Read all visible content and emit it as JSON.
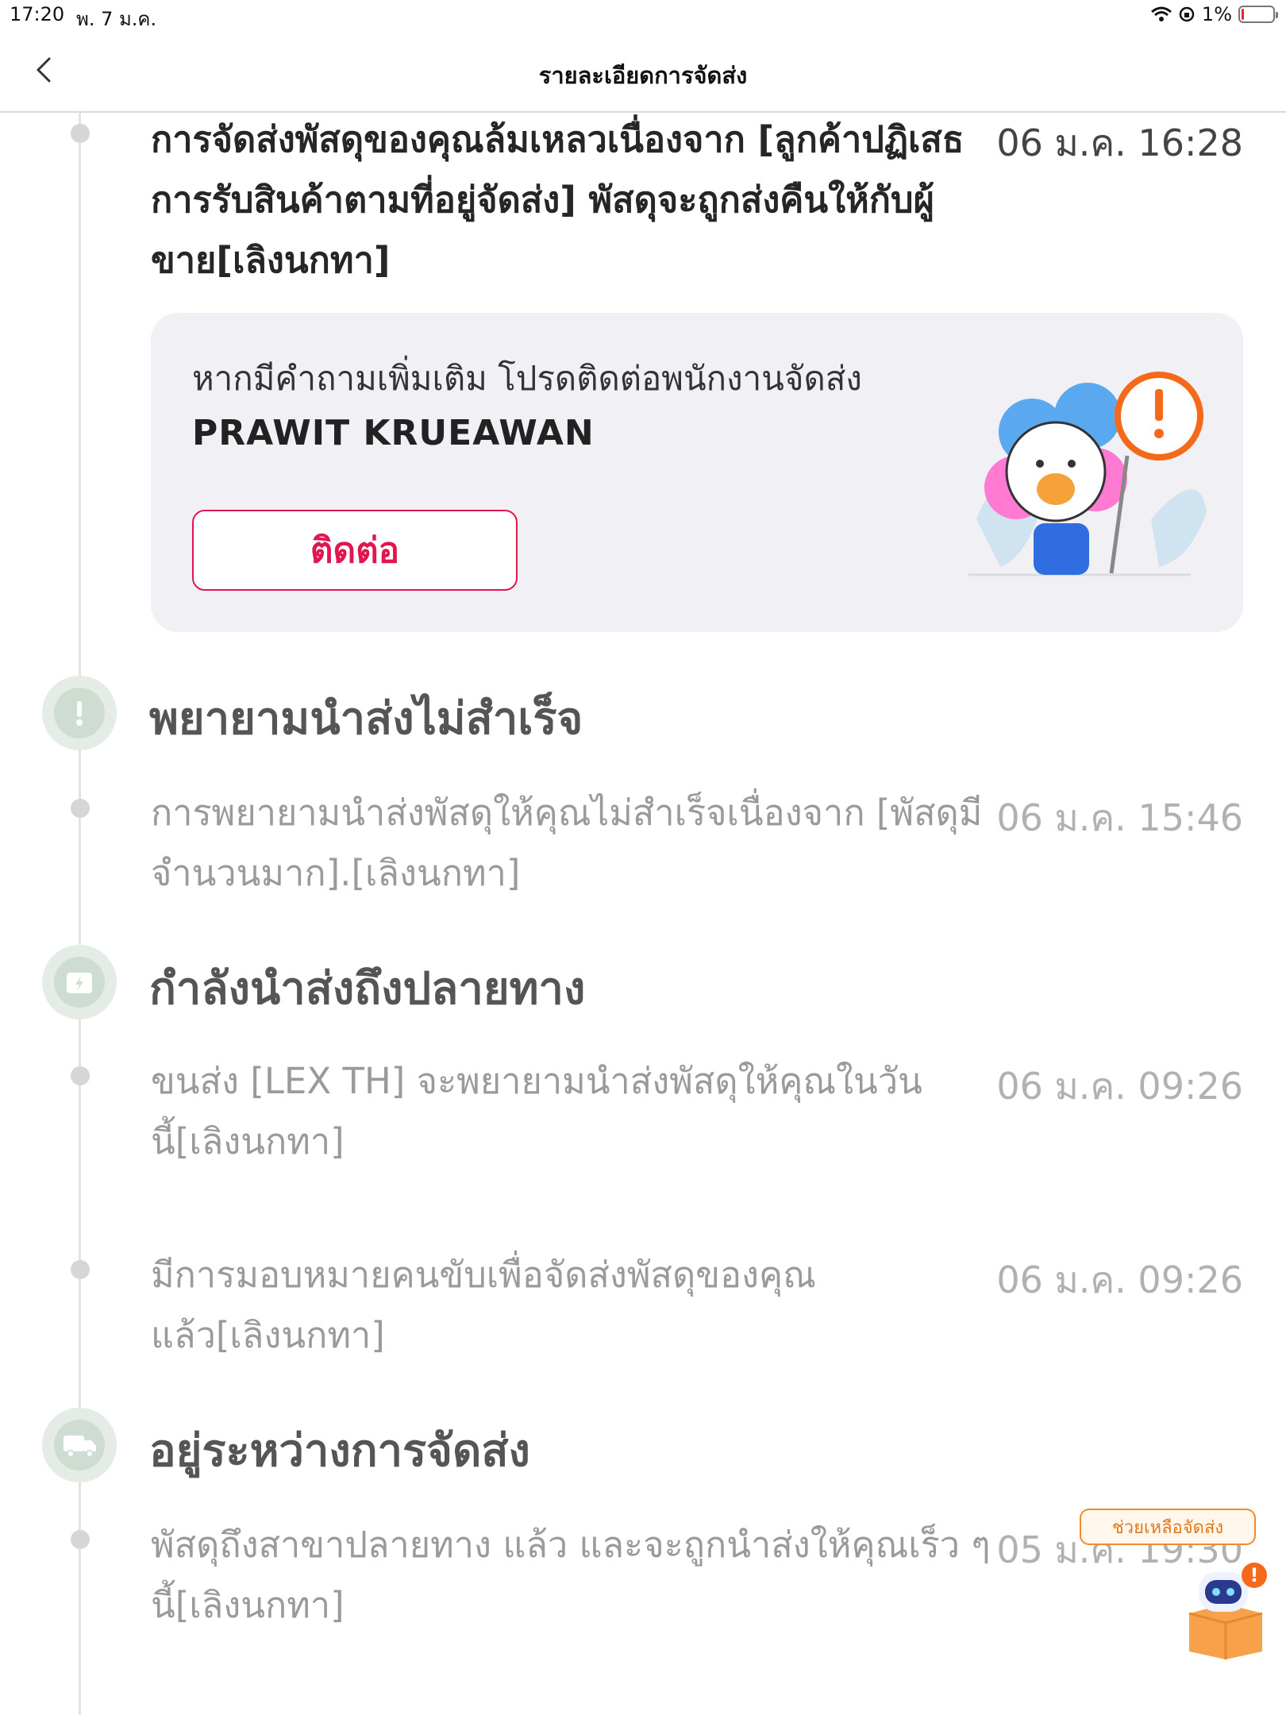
{
  "status_bar": {
    "time": "17:20",
    "date": "พ. 7 ม.ค.",
    "battery": "1%"
  },
  "header": {
    "title": "รายละเอียดการจัดส่ง"
  },
  "events": [
    {
      "text": "การจัดส่งพัสดุของคุณล้มเหลวเนื่องจาก [ลูกค้าปฏิเสธการรับสินค้าตามที่อยู่จัดส่ง] พัสดุจะถูกส่งคืนให้กับผู้ขาย[เลิงนกทา]",
      "time": "06 ม.ค. 16:28"
    },
    {
      "text": "การพยายามนำส่งพัสดุให้คุณไม่สำเร็จเนื่องจาก [พัสดุมีจำนวนมาก].[เลิงนกทา]",
      "time": "06 ม.ค. 15:46"
    },
    {
      "text": "ขนส่ง [LEX TH] จะพยายามนำส่งพัสดุให้คุณในวันนี้[เลิงนกทา]",
      "time": "06 ม.ค. 09:26"
    },
    {
      "text": "มีการมอบหมายคนขับเพื่อจัดส่งพัสดุของคุณแล้ว[เลิงนกทา]",
      "time": "06 ม.ค. 09:26"
    },
    {
      "text": "พัสดุถึงสาขาปลายทาง แล้ว และจะถูกนำส่งให้คุณเร็ว ๆ นี้[เลิงนกทา]",
      "time": "05 ม.ค. 19:30"
    }
  ],
  "stages": [
    {
      "title": "พยายามนำส่งไม่สำเร็จ",
      "icon": "exclamation-icon"
    },
    {
      "title": "กำลังนำส่งถึงปลายทาง",
      "icon": "delivery-box-icon"
    },
    {
      "title": "อยู่ระหว่างการจัดส่ง",
      "icon": "truck-icon"
    }
  ],
  "contact_card": {
    "question": "หากมีคำถามเพิ่มเติม โปรดติดต่อพนักงานจัดส่ง",
    "courier_name": "PRAWIT KRUEAWAN",
    "button_label": "ติดต่อ"
  },
  "help_widget": {
    "label": "ช่วยเหลือจัดส่ง",
    "badge": "!"
  },
  "colors": {
    "accent": "#e0174f",
    "help_orange": "#f08a2c",
    "stage_icon_bg": "#e5ece6"
  }
}
